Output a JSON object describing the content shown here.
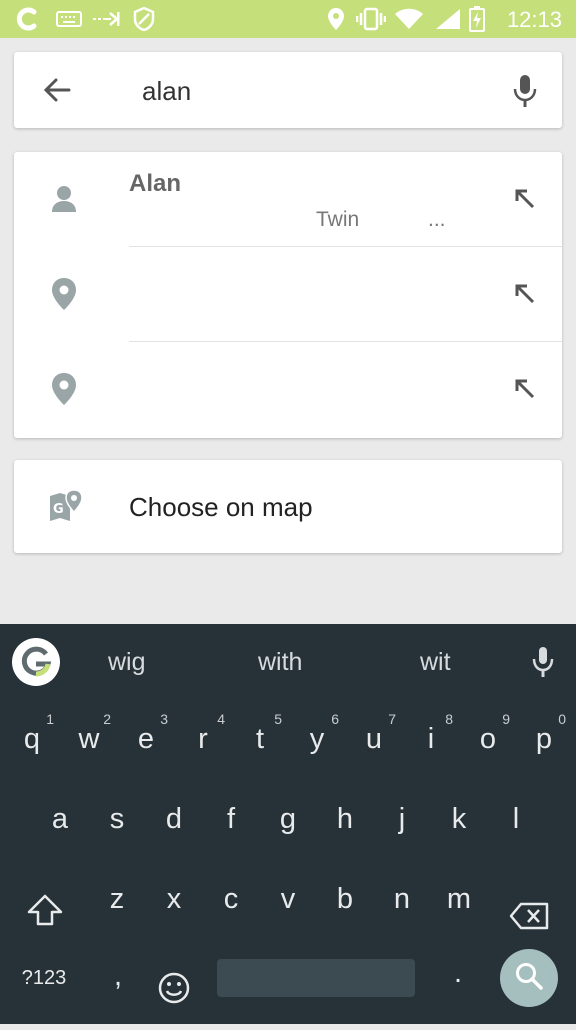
{
  "status_bar": {
    "time": "12:13",
    "icons": [
      "c-app-icon",
      "keyboard-icon",
      "arrow-icon",
      "shield-icon",
      "location-icon",
      "vibrate-icon",
      "wifi-icon",
      "battery-charging-icon"
    ]
  },
  "search": {
    "query": "alan",
    "back_icon": "arrow-left-icon",
    "mic_icon": "mic-icon"
  },
  "results": [
    {
      "icon": "person-icon",
      "title": "Alan",
      "sub1": "Twin",
      "sub2": "...",
      "action_icon": "arrow-up-left-icon"
    },
    {
      "icon": "place-icon",
      "title": "",
      "sub1": "",
      "sub2": "",
      "action_icon": "arrow-up-left-icon"
    },
    {
      "icon": "place-icon",
      "title": "",
      "sub1": "",
      "sub2": "",
      "action_icon": "arrow-up-left-icon"
    }
  ],
  "choose_on_map": {
    "label": "Choose on map",
    "icon": "map-pin-icon"
  },
  "keyboard": {
    "suggestions": [
      "wig",
      "with",
      "wit"
    ],
    "row1": [
      {
        "key": "q",
        "hint": "1"
      },
      {
        "key": "w",
        "hint": "2"
      },
      {
        "key": "e",
        "hint": "3"
      },
      {
        "key": "r",
        "hint": "4"
      },
      {
        "key": "t",
        "hint": "5"
      },
      {
        "key": "y",
        "hint": "6"
      },
      {
        "key": "u",
        "hint": "7"
      },
      {
        "key": "i",
        "hint": "8"
      },
      {
        "key": "o",
        "hint": "9"
      },
      {
        "key": "p",
        "hint": "0"
      }
    ],
    "row2": [
      "a",
      "s",
      "d",
      "f",
      "g",
      "h",
      "j",
      "k",
      "l"
    ],
    "row3": [
      "z",
      "x",
      "c",
      "v",
      "b",
      "n",
      "m"
    ],
    "row4": {
      "symbols": "?123",
      "comma": ",",
      "period": "."
    }
  },
  "colors": {
    "status_bar": "#c5e07a",
    "keyboard_bg": "#263238",
    "search_key": "#a5bfbe",
    "icon_gray": "#9aa5a8"
  }
}
